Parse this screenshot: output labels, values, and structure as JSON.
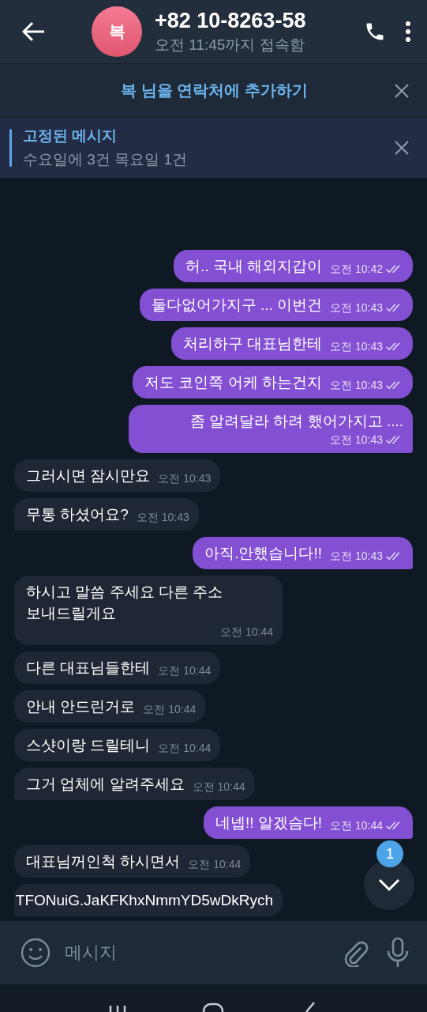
{
  "header": {
    "avatar_letter": "복",
    "title": "+82 10-8263-58",
    "status": "오전 11:45까지 접속함"
  },
  "contact_banner": {
    "text": "복 님을 연락처에 추가하기"
  },
  "pinned": {
    "title": "고정된 메시지",
    "text": "수요일에 3건 목요일 1건"
  },
  "messages": [
    {
      "kind": "outgoing",
      "text": "허.. 국내 해외지갑이",
      "time": "오전 10:42"
    },
    {
      "kind": "outgoing",
      "text": "둘다없어가지구 ... 이번건",
      "time": "오전 10:43"
    },
    {
      "kind": "outgoing",
      "text": "처리하구 대표님한테",
      "time": "오전 10:43"
    },
    {
      "kind": "outgoing",
      "text": "저도 코인쪽 어케 하는건지",
      "time": "오전 10:43"
    },
    {
      "kind": "outgoing",
      "text": "좀 알려달라 하려 했어가지고 ....",
      "time": "오전 10:43"
    },
    {
      "kind": "incoming",
      "text": "그러시면 잠시만요",
      "time": "오전 10:43"
    },
    {
      "kind": "incoming",
      "text": "무통 하셨어요?",
      "time": "오전 10:43"
    },
    {
      "kind": "outgoing",
      "text": "아직.안했습니다!!",
      "time": "오전 10:43"
    },
    {
      "kind": "incoming",
      "text": "하시고 말씀 주세요 다른 주소 보내드릴게요",
      "time": "오전 10:44"
    },
    {
      "kind": "incoming",
      "text": "다른 대표님들한테",
      "time": "오전 10:44"
    },
    {
      "kind": "incoming",
      "text": "안내 안드린거로",
      "time": "오전 10:44"
    },
    {
      "kind": "incoming",
      "text": "스샷이랑 드릴테니",
      "time": "오전 10:44"
    },
    {
      "kind": "incoming",
      "text": "그거 업체에 알려주세요",
      "time": "오전 10:44"
    },
    {
      "kind": "outgoing",
      "text": "네넵!! 알겠슴다!",
      "time": "오전 10:44"
    },
    {
      "kind": "incoming",
      "text": "대표님꺼인척 하시면서",
      "time": "오전 10:44"
    },
    {
      "kind": "incoming",
      "text": "TFONuiG.JaKFKhxNmmYD5wDkRych"
    }
  ],
  "scroll_button": {
    "badge": "1"
  },
  "composer": {
    "placeholder": "메시지"
  }
}
